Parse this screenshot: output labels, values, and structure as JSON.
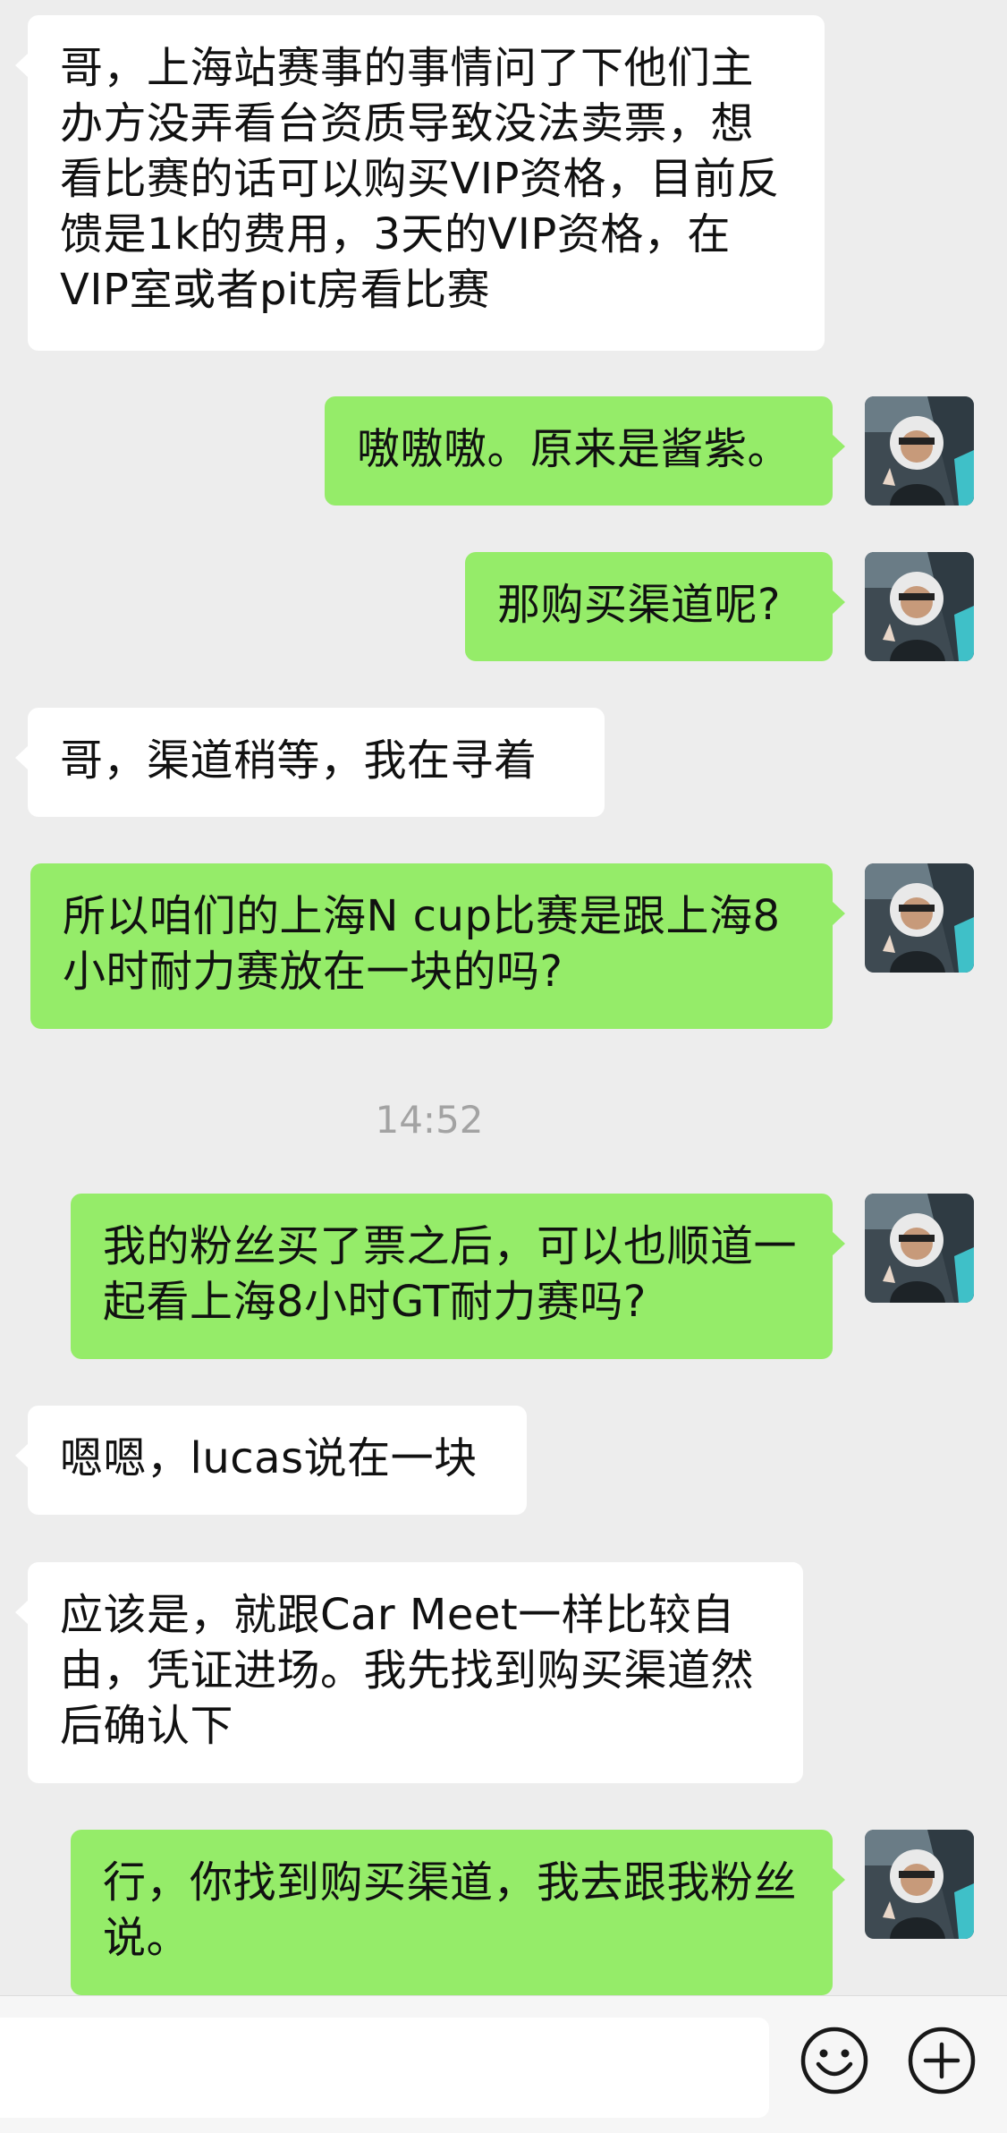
{
  "messages": [
    {
      "side": "in",
      "text": "哥，上海站赛事的事情问了下他们主办方没弄看台资质导致没法卖票，想看比赛的话可以购买VIP资格，目前反馈是1k的费用，3天的VIP资格，在VIP室或者pit房看比赛"
    },
    {
      "side": "out",
      "text": "嗷嗷嗷。原来是酱紫。"
    },
    {
      "side": "out",
      "text": "那购买渠道呢?"
    },
    {
      "side": "in",
      "text": "哥，渠道稍等，我在寻着"
    },
    {
      "side": "out",
      "text": "所以咱们的上海N cup比赛是跟上海8小时耐力赛放在一块的吗?"
    },
    {
      "side": "out",
      "text": "我的粉丝买了票之后，可以也顺道一起看上海8小时GT耐力赛吗?"
    },
    {
      "side": "in",
      "text": "嗯嗯，lucas说在一块"
    },
    {
      "side": "in",
      "text": "应该是，就跟Car Meet一样比较自由，凭证进场。我先找到购买渠道然后确认下"
    },
    {
      "side": "out",
      "text": "行，你找到购买渠道，我去跟我粉丝说。"
    }
  ],
  "timestamp": "14:52",
  "input": {
    "value": ""
  },
  "colors": {
    "background": "#ededed",
    "incoming_bubble": "#ffffff",
    "outgoing_bubble": "#95ec69",
    "timestamp_text": "#a3a3a3"
  },
  "icons": {
    "emoji": "smiley-face-icon",
    "more": "plus-circle-icon",
    "avatar": "user-avatar"
  }
}
